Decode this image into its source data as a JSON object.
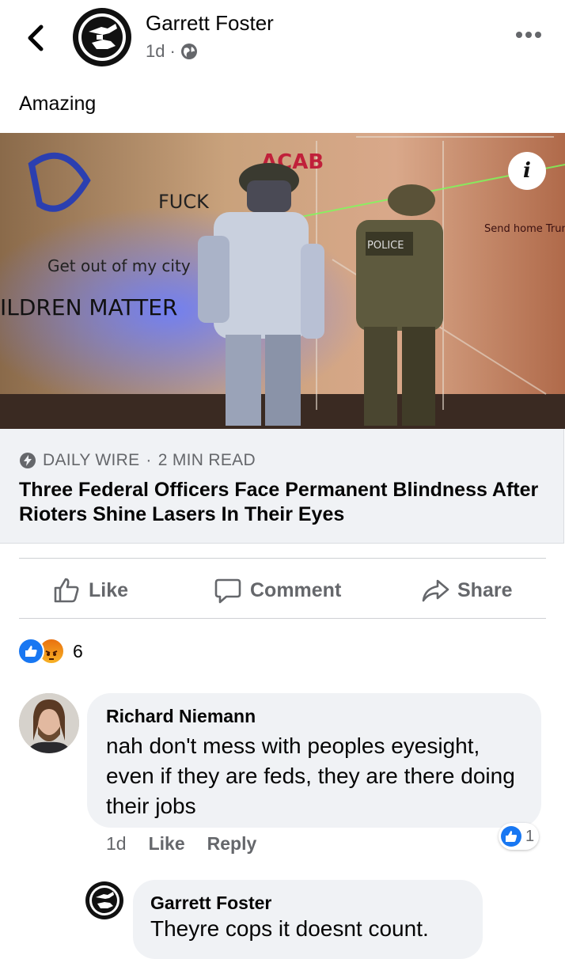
{
  "post": {
    "author": "Garrett Foster",
    "time": "1d",
    "separator": "·",
    "body": "Amazing"
  },
  "link_card": {
    "source": "DAILY WIRE",
    "dot": "·",
    "read_time": "2 MIN READ",
    "headline": "Three Federal Officers Face Permanent Blindness After Rioters Shine Lasers In Their Eyes",
    "info_label": "i",
    "image_texts": {
      "acab": "ACAB",
      "police": "POLICE",
      "get_out": "Get out of my city",
      "children_matter": "ILDREN MATTER",
      "fuck": "FUCK",
      "send_home": "Send home Trump"
    }
  },
  "actions": {
    "like": "Like",
    "comment": "Comment",
    "share": "Share"
  },
  "reactions": {
    "count": "6",
    "types": [
      "like-icon",
      "angry-icon"
    ]
  },
  "comments": [
    {
      "author": "Richard Niemann",
      "text": "nah don't mess with peoples eyesight, even if they are feds, they are there doing their jobs",
      "time": "1d",
      "like": "Like",
      "reply": "Reply",
      "like_count": "1"
    },
    {
      "author": "Garrett Foster",
      "text": "Theyre cops it doesnt count."
    }
  ],
  "colors": {
    "facebook_blue": "#1877f2",
    "secondary_text": "#65676b",
    "bubble_bg": "#f0f2f5"
  }
}
